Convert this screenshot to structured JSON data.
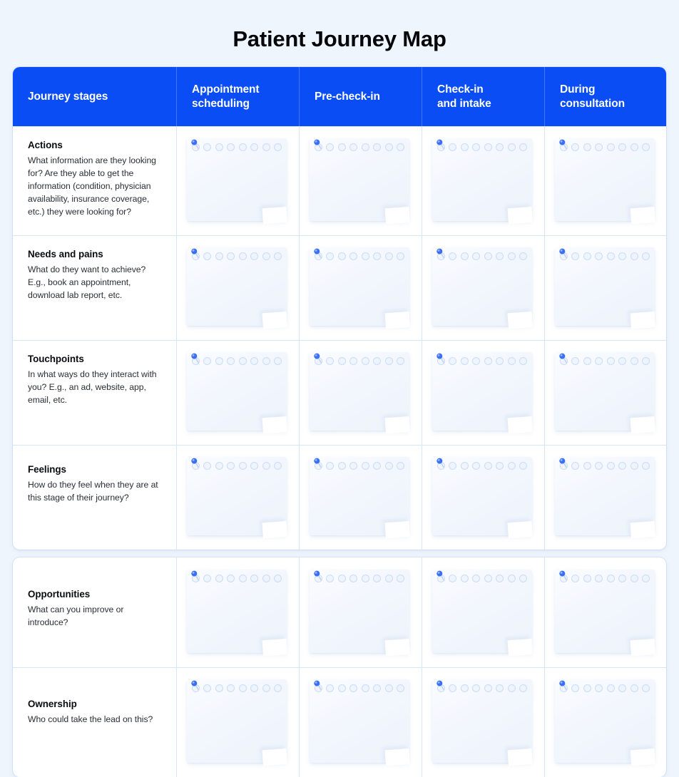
{
  "page": {
    "title": "Patient Journey Map",
    "background_color": "#eff5fd",
    "accent_color": "#0b4df4",
    "card_color": "#ffffff"
  },
  "table": {
    "columns": [
      {
        "id": "journey-stages",
        "label": "Journey stages"
      },
      {
        "id": "appointment-scheduling",
        "label": "Appointment\nscheduling"
      },
      {
        "id": "pre-check-in",
        "label": "Pre-check-in"
      },
      {
        "id": "check-in-and-intake",
        "label": "Check-in\nand intake"
      },
      {
        "id": "during-consultation",
        "label": "During\nconsultation"
      }
    ],
    "blocks": [
      {
        "id": "block-primary",
        "rows": [
          {
            "id": "actions",
            "title": "Actions",
            "description": "What information are they looking for? Are they able to get the information (condition, physician availability, insurance coverage, etc.) they were looking for?",
            "note_placeholders": 4
          },
          {
            "id": "needs-and-pains",
            "title": "Needs and pains",
            "description": "What do they want to achieve? E.g., book an appointment, download lab report, etc.",
            "note_placeholders": 4
          },
          {
            "id": "touchpoints",
            "title": "Touchpoints",
            "description": "In what ways do they interact with you? E.g., an ad, website, app, email, etc.",
            "note_placeholders": 4
          },
          {
            "id": "feelings",
            "title": "Feelings",
            "description": "How do they feel when they are at this stage of their journey?",
            "note_placeholders": 4
          }
        ]
      },
      {
        "id": "block-secondary",
        "rows": [
          {
            "id": "opportunities",
            "title": "Opportunities",
            "description": "What can you improve or introduce?",
            "note_placeholders": 4
          },
          {
            "id": "ownership",
            "title": "Ownership",
            "description": "Who could take the lead on this?",
            "note_placeholders": 4
          }
        ]
      }
    ]
  },
  "note_card": {
    "icon": "push-pin-icon",
    "ring_holes": 8,
    "placeholder_text": ""
  }
}
